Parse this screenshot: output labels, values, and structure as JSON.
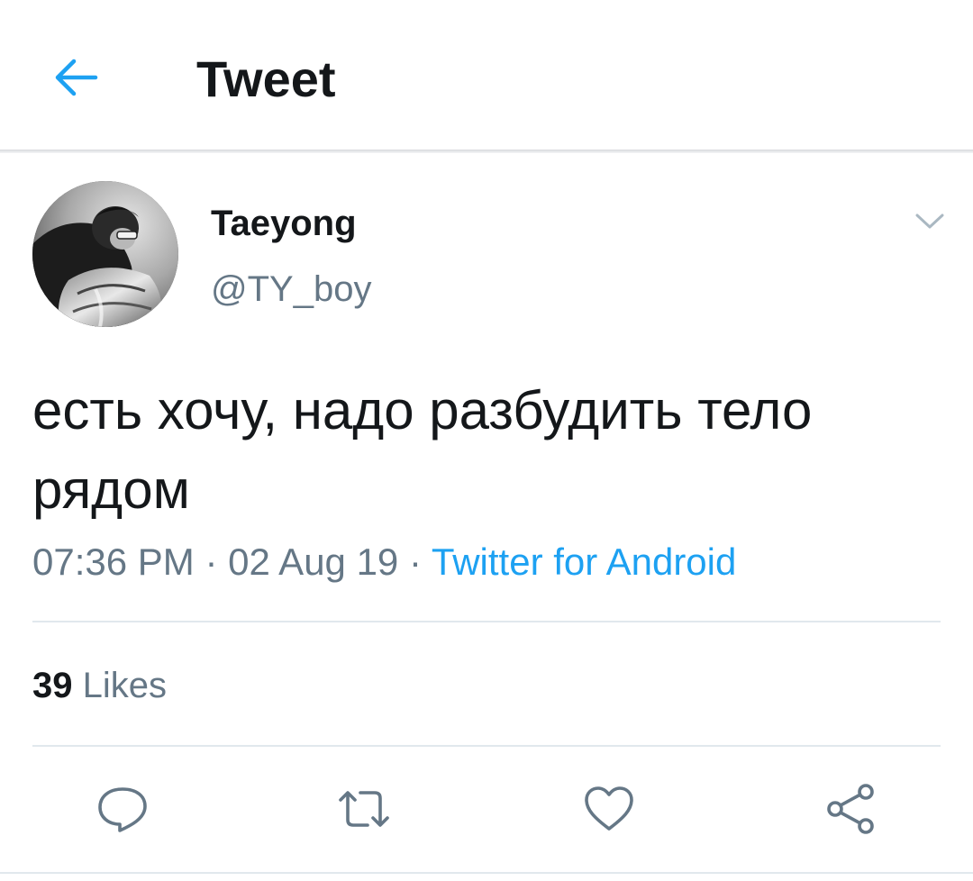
{
  "header": {
    "title": "Tweet",
    "back_icon": "arrow-left-icon",
    "accent_color": "#1da1f2"
  },
  "tweet": {
    "author": {
      "display_name": "Taeyong",
      "handle": "@TY_boy",
      "avatar_icon": "profile-photo"
    },
    "text": "есть хочу, надо разбудить тело рядом",
    "time": "07:36 PM",
    "separator": " · ",
    "date": "02 Aug 19",
    "source": "Twitter for Android",
    "likes": {
      "count": "39",
      "label": "Likes"
    }
  },
  "actions": [
    {
      "name": "reply",
      "icon": "reply-icon"
    },
    {
      "name": "retweet",
      "icon": "retweet-icon"
    },
    {
      "name": "like",
      "icon": "heart-icon"
    },
    {
      "name": "share",
      "icon": "share-icon"
    }
  ],
  "colors": {
    "text_primary": "#14171a",
    "text_secondary": "#657786",
    "link": "#1da1f2",
    "divider": "#e1e8ed"
  }
}
